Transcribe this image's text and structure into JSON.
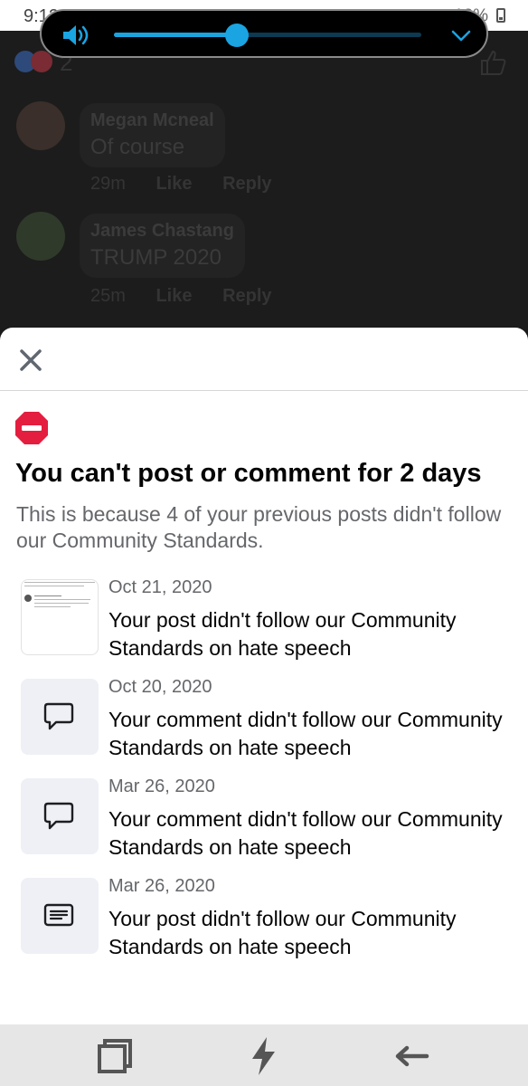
{
  "status_bar": {
    "time": "9:12",
    "battery": "13%"
  },
  "volume_panel": {
    "level_percent": 40,
    "icons": [
      "speaker-icon",
      "chevron-down-icon"
    ]
  },
  "background": {
    "reaction_count": "2",
    "comments": [
      {
        "author": "Megan Mcneal",
        "text": "Of course",
        "time": "29m",
        "like": "Like",
        "reply": "Reply"
      },
      {
        "author": "James Chastang",
        "text": "TRUMP 2020",
        "time": "25m",
        "like": "Like",
        "reply": "Reply"
      }
    ]
  },
  "sheet": {
    "title": "You can't post or comment for 2 days",
    "subtitle": "This is because 4 of your previous posts didn't follow our Community Standards.",
    "violations": [
      {
        "date": "Oct 21, 2020",
        "text": "Your post didn't follow our Community Standards on hate speech",
        "thumb": "post-preview"
      },
      {
        "date": "Oct 20, 2020",
        "text": "Your comment didn't follow our Community Standards on hate speech",
        "thumb": "comment-icon"
      },
      {
        "date": "Mar 26, 2020",
        "text": "Your comment didn't follow our Community Standards on hate speech",
        "thumb": "comment-icon"
      },
      {
        "date": "Mar 26, 2020",
        "text": "Your post didn't follow our Community Standards on hate speech",
        "thumb": "post-icon"
      }
    ]
  },
  "nav_bar": {
    "buttons": [
      "recent-apps-icon",
      "bolt-icon",
      "back-arrow-icon"
    ]
  },
  "colors": {
    "accent_blue": "#1aa4e2",
    "stop_red": "#e41e3f",
    "secondary_text": "#65676b"
  }
}
